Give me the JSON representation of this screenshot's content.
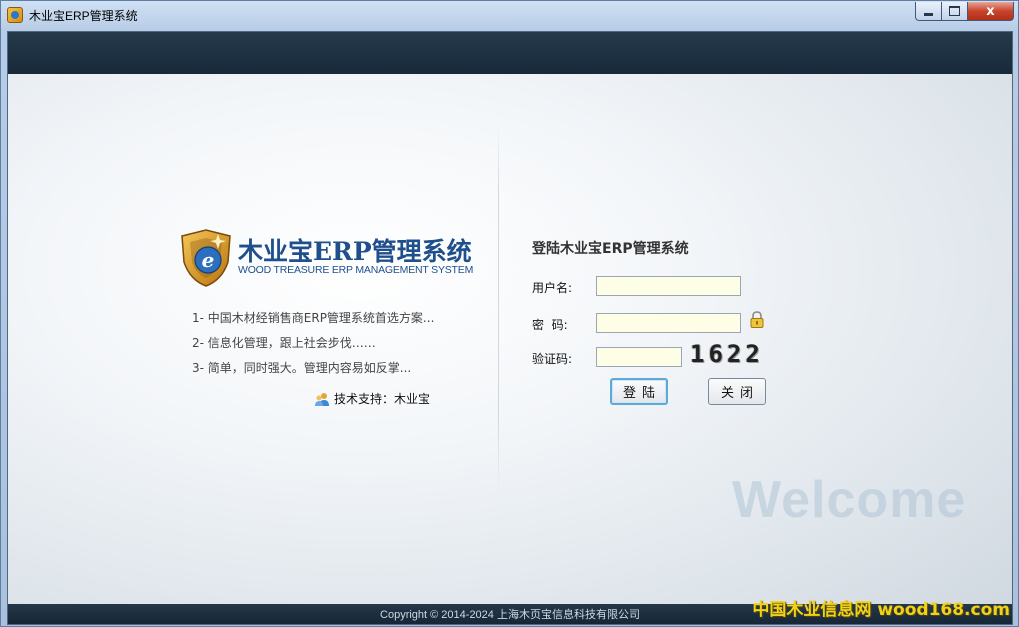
{
  "window": {
    "title": "木业宝ERP管理系统",
    "close_glyph": "x"
  },
  "branding": {
    "name": "木业宝ERP管理系统",
    "subtitle": "WOOD TREASURE ERP MANAGEMENT SYSTEM",
    "logo_letter": "e"
  },
  "features": [
    "1- 中国木材经销售商ERP管理系统首选方案...",
    "2- 信息化管理，跟上社会步伐……",
    "3- 简单，同时强大。管理内容易如反掌..."
  ],
  "support": {
    "text": "技术支持：木业宝"
  },
  "login": {
    "title": "登陆木业宝ERP管理系统",
    "username_label": "用户名:",
    "username_value": "",
    "password_label": "密  码:",
    "password_value": "",
    "captcha_label": "验证码:",
    "captcha_value": "",
    "captcha_code": "1622",
    "login_button": "登陆",
    "close_button": "关闭"
  },
  "welcome_text": "Welcome",
  "footer": {
    "copyright": "Copyright © 2014-2024 上海木页宝信息科技有限公司"
  },
  "watermark": "中国木业信息网 wood168.com",
  "colors": {
    "brand_blue": "#1f4f8c",
    "dark_band": "#1d3144",
    "input_bg": "#fefee6",
    "shield_gold": "#e0a020"
  }
}
